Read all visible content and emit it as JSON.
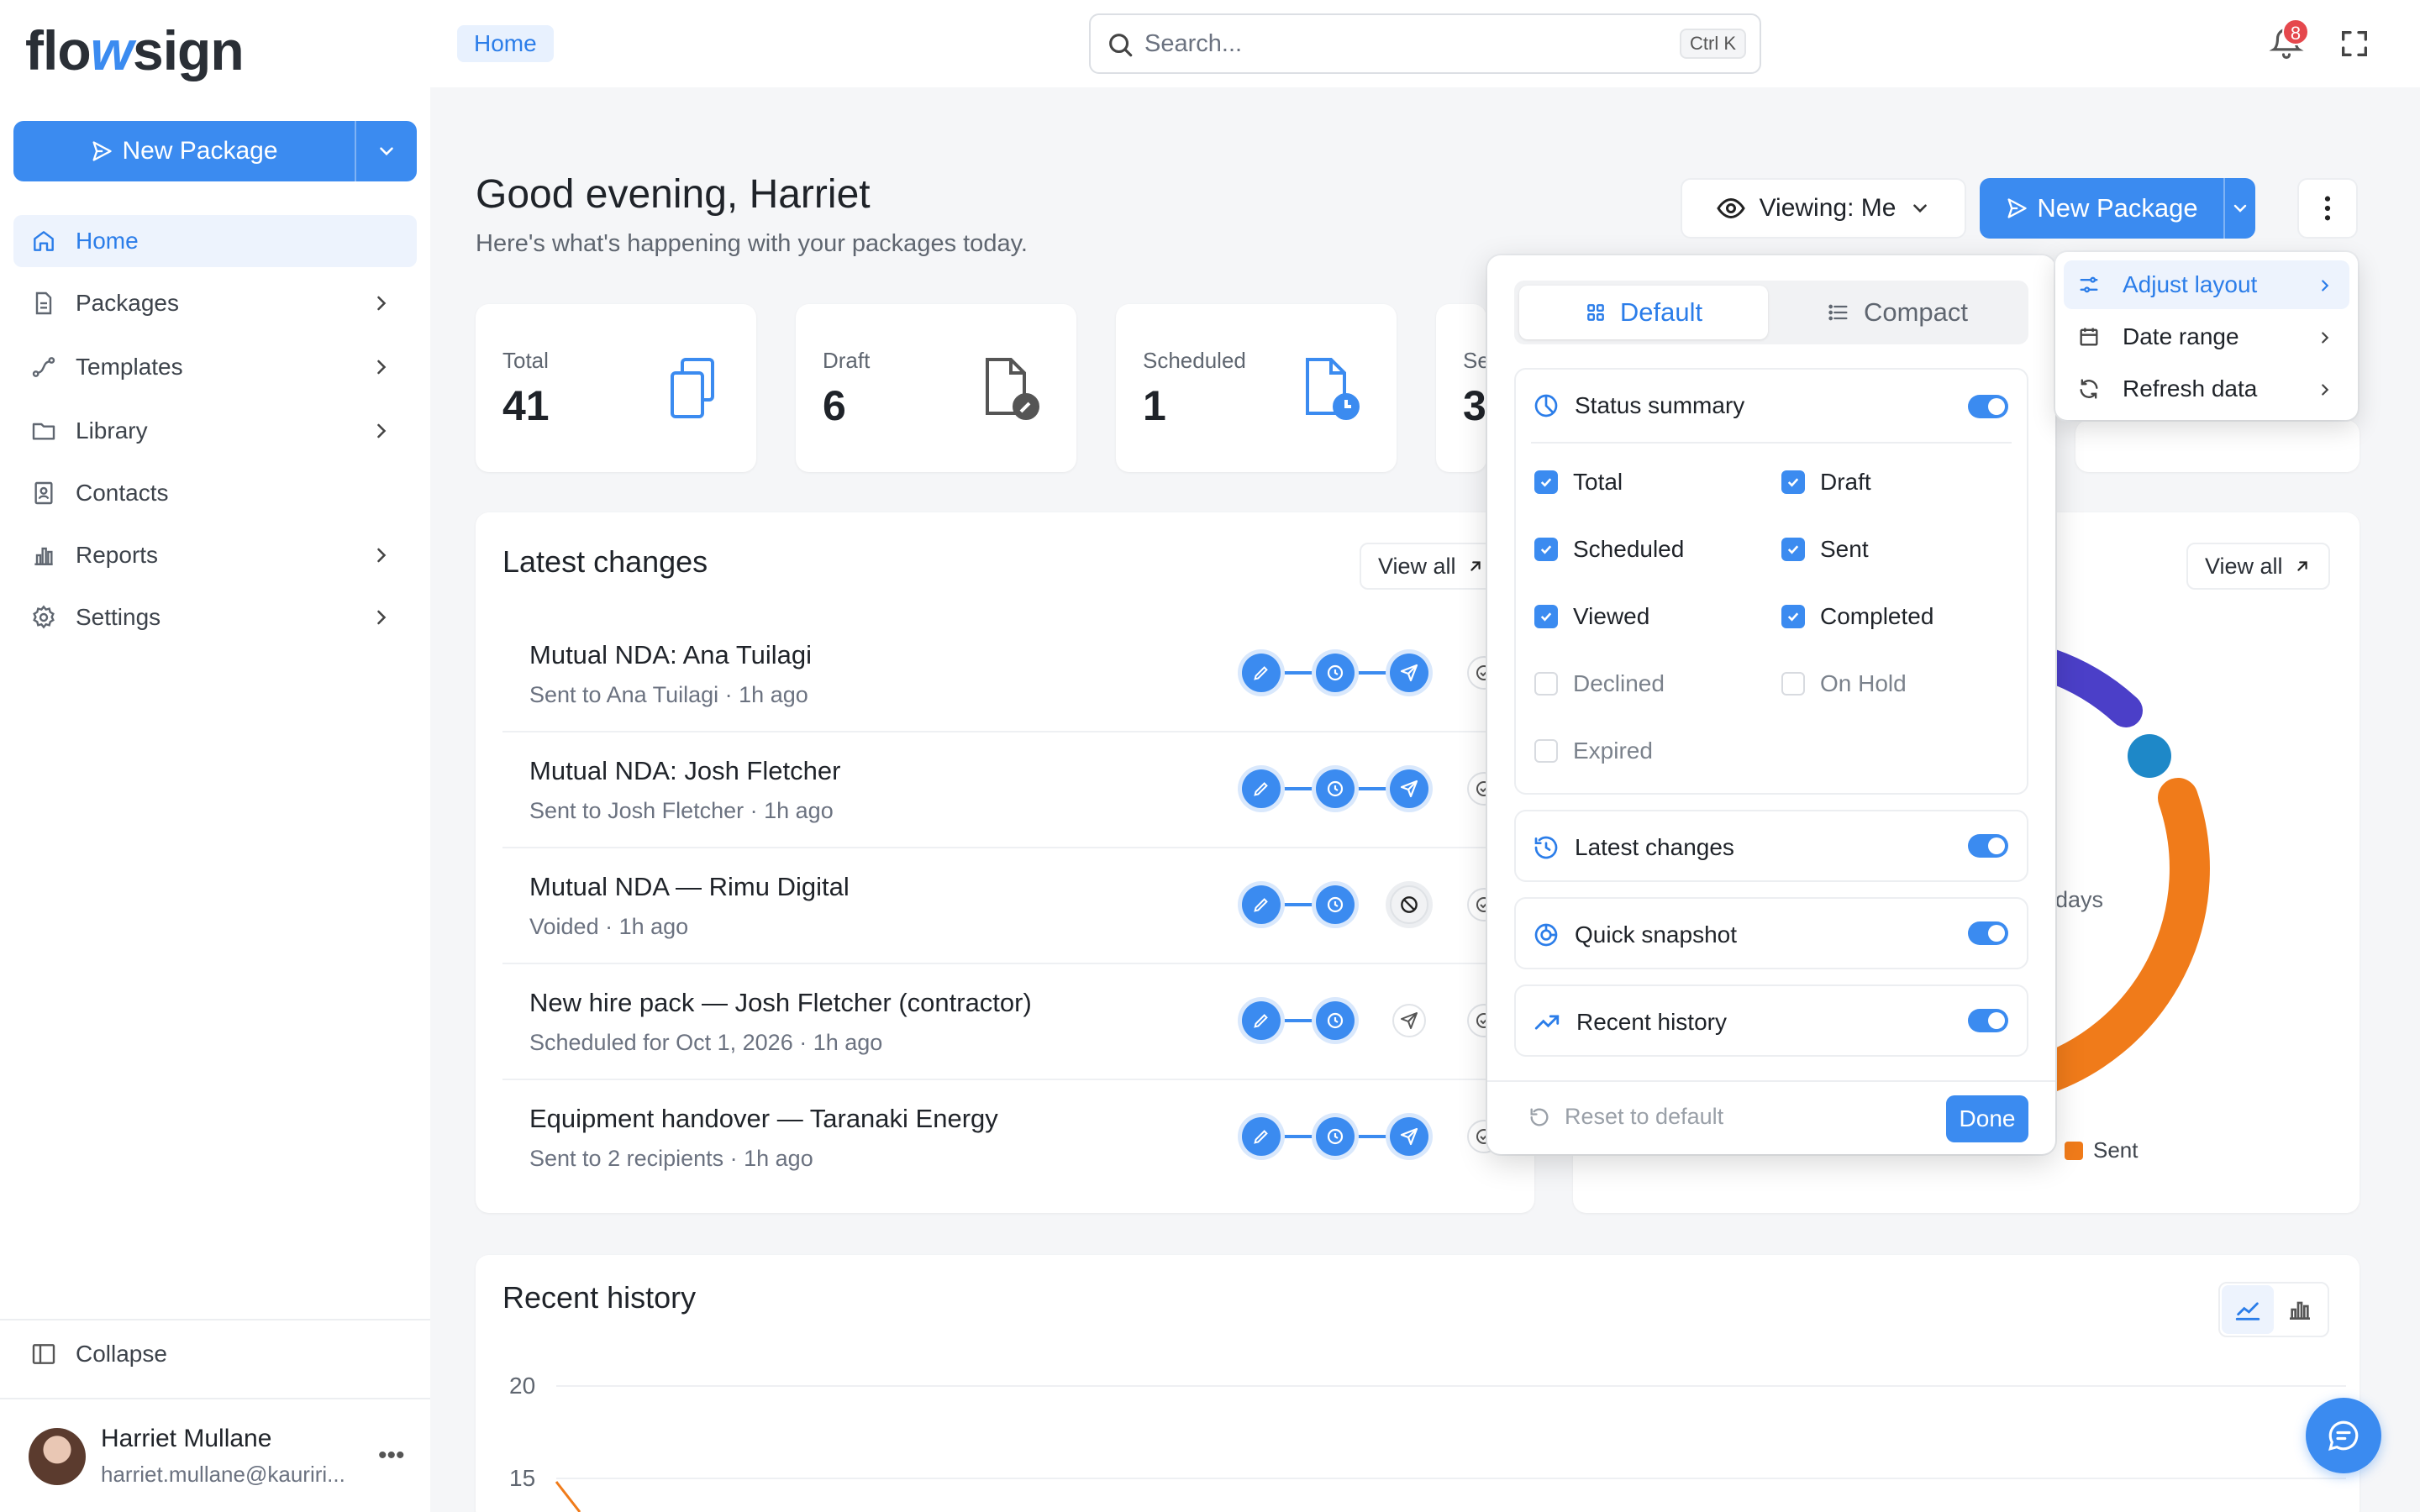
{
  "app": {
    "logo": "flowsign",
    "logo_parts": [
      "flo",
      "w",
      "sign"
    ]
  },
  "topbar": {
    "breadcrumb": "Home",
    "search_placeholder": "Search...",
    "search_shortcut": "Ctrl K",
    "notification_count": "8"
  },
  "sidebar": {
    "new_package": "New Package",
    "items": [
      {
        "label": "Home",
        "icon": "home-icon",
        "active": true
      },
      {
        "label": "Packages",
        "icon": "document-icon"
      },
      {
        "label": "Templates",
        "icon": "route-icon"
      },
      {
        "label": "Library",
        "icon": "folder-icon"
      },
      {
        "label": "Contacts",
        "icon": "contact-card-icon"
      },
      {
        "label": "Reports",
        "icon": "bar-chart-icon"
      },
      {
        "label": "Settings",
        "icon": "gear-icon"
      }
    ],
    "collapse": "Collapse",
    "user": {
      "name": "Harriet Mullane",
      "email": "harriet.mullane@kauriri..."
    }
  },
  "header": {
    "greeting": "Good evening, Harriet",
    "subtitle": "Here's what's happening with your packages today.",
    "viewing": "Viewing: Me",
    "new_package": "New Package"
  },
  "stats": [
    {
      "label": "Total",
      "value": "41"
    },
    {
      "label": "Draft",
      "value": "6"
    },
    {
      "label": "Scheduled",
      "value": "1"
    },
    {
      "label": "Se",
      "value": "3"
    }
  ],
  "latest_changes": {
    "title": "Latest changes",
    "view_all": "View all",
    "rows": [
      {
        "title": "Mutual NDA: Ana Tuilagi",
        "sub": "Sent to Ana Tuilagi · 1h ago",
        "state": "sent"
      },
      {
        "title": "Mutual NDA: Josh Fletcher",
        "sub": "Sent to Josh Fletcher · 1h ago",
        "state": "sent"
      },
      {
        "title": "Mutual NDA — Rimu Digital",
        "sub": "Voided · 1h ago",
        "state": "voided"
      },
      {
        "title": "New hire pack — Josh Fletcher (contractor)",
        "sub": "Scheduled for Oct 1, 2026 · 1h ago",
        "state": "scheduled"
      },
      {
        "title": "Equipment handover — Taranaki Energy",
        "sub": "Sent to 2 recipients · 1h ago",
        "state": "sent"
      }
    ]
  },
  "snapshot": {
    "view_all": "View all",
    "days_fragment": "days",
    "legend_sent": "Sent"
  },
  "recent_history": {
    "title": "Recent history",
    "y_ticks": [
      "20",
      "15"
    ]
  },
  "layout_popover": {
    "tab_default": "Default",
    "tab_compact": "Compact",
    "status_summary": "Status summary",
    "checks": [
      {
        "label": "Total",
        "checked": true
      },
      {
        "label": "Draft",
        "checked": true
      },
      {
        "label": "Scheduled",
        "checked": true
      },
      {
        "label": "Sent",
        "checked": true
      },
      {
        "label": "Viewed",
        "checked": true
      },
      {
        "label": "Completed",
        "checked": true
      },
      {
        "label": "Declined",
        "checked": false
      },
      {
        "label": "On Hold",
        "checked": false
      },
      {
        "label": "Expired",
        "checked": false
      }
    ],
    "sections": [
      "Latest changes",
      "Quick snapshot",
      "Recent history"
    ],
    "reset": "Reset to default",
    "done": "Done"
  },
  "kebab_menu": {
    "items": [
      "Adjust layout",
      "Date range",
      "Refresh data"
    ]
  },
  "colors": {
    "accent": "#3b8bf0",
    "orange": "#f07b1a",
    "indigo": "#4b3fc8",
    "teal": "#1e88c8"
  }
}
